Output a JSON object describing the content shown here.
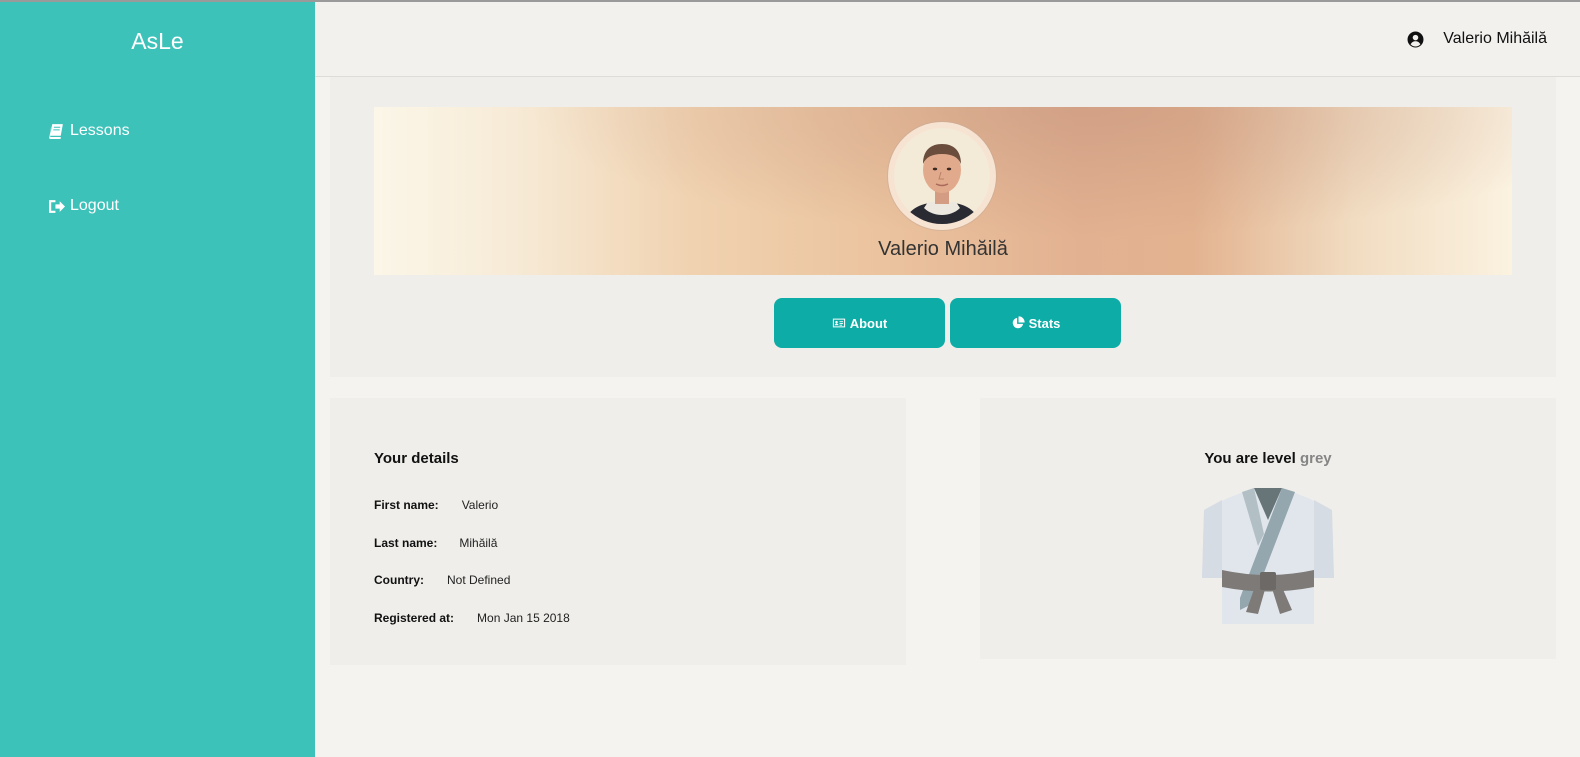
{
  "app": {
    "brand": "AsLe"
  },
  "sidebar": {
    "items": [
      {
        "label": "Lessons",
        "icon": "book-icon"
      },
      {
        "label": "Logout",
        "icon": "sign-out-icon"
      }
    ]
  },
  "header": {
    "user_name": "Valerio Mihăilă",
    "icon": "user-circle-icon"
  },
  "profile": {
    "name": "Valerio Mihăilă",
    "tabs": [
      {
        "label": "About",
        "icon": "id-card-icon"
      },
      {
        "label": "Stats",
        "icon": "pie-chart-icon"
      }
    ]
  },
  "details": {
    "title": "Your details",
    "rows": [
      {
        "label": "First name:",
        "value": "Valerio"
      },
      {
        "label": "Last name:",
        "value": "Mihăilă"
      },
      {
        "label": "Country:",
        "value": "Not Defined"
      },
      {
        "label": "Registered at:",
        "value": "Mon Jan 15 2018"
      }
    ]
  },
  "level": {
    "title_prefix": "You are level",
    "level_name": "grey",
    "belt_color": "#7d7a77"
  },
  "colors": {
    "sidebar": "#3dc2ba",
    "button": "#0eaca6",
    "background": "#f4f3ef"
  }
}
